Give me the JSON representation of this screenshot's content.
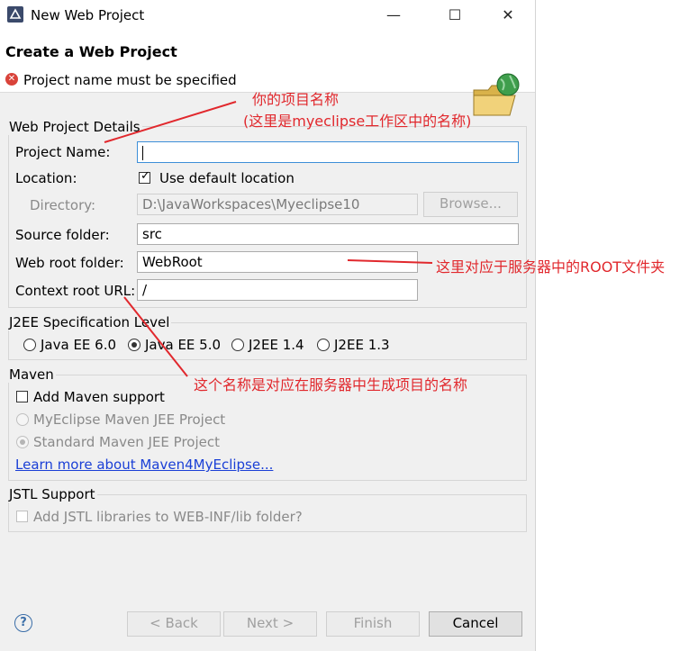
{
  "window": {
    "title": "New Web Project",
    "controls": {
      "minimize": "—",
      "maximize": "☐",
      "close": "✕"
    }
  },
  "header": {
    "title": "Create a Web Project",
    "message": "Project name must be specified",
    "error_icon": "✕"
  },
  "web_project_details": {
    "group_label": "Web Project Details",
    "project_name_label": "Project Name:",
    "project_name_value": "",
    "location_label": "Location:",
    "use_default_location_label": "Use default location",
    "use_default_location_checked": true,
    "directory_label": "Directory:",
    "directory_value": "D:\\JavaWorkspaces\\Myeclipse10",
    "browse_button": "Browse...",
    "source_folder_label": "Source folder:",
    "source_folder_value": "src",
    "web_root_label": "Web root folder:",
    "web_root_value": "WebRoot",
    "context_root_label": "Context root URL:",
    "context_root_value": "/"
  },
  "j2ee": {
    "group_label": "J2EE Specification Level",
    "options": [
      {
        "label": "Java EE 6.0",
        "selected": false
      },
      {
        "label": "Java EE 5.0",
        "selected": true
      },
      {
        "label": "J2EE 1.4",
        "selected": false
      },
      {
        "label": "J2EE 1.3",
        "selected": false
      }
    ]
  },
  "maven": {
    "group_label": "Maven",
    "add_support_label": "Add Maven support",
    "option_1": "MyEclipse Maven JEE Project",
    "option_2": "Standard Maven JEE Project",
    "learn_more_link": "Learn more about Maven4MyEclipse..."
  },
  "jstl": {
    "group_label": "JSTL Support",
    "add_libraries_label": "Add JSTL libraries to WEB-INF/lib folder?"
  },
  "footer": {
    "help_icon": "?",
    "back_button": "< Back",
    "next_button": "Next >",
    "finish_button": "Finish",
    "cancel_button": "Cancel"
  },
  "annotations": {
    "project_name_note_1": "你的项目名称",
    "project_name_note_2": "(这里是myeclipse工作区中的名称)",
    "web_root_note": "这里对应于服务器中的ROOT文件夹",
    "context_root_note": "这个名称是对应在服务器中生成项目的名称",
    "color": "#e1282d"
  }
}
